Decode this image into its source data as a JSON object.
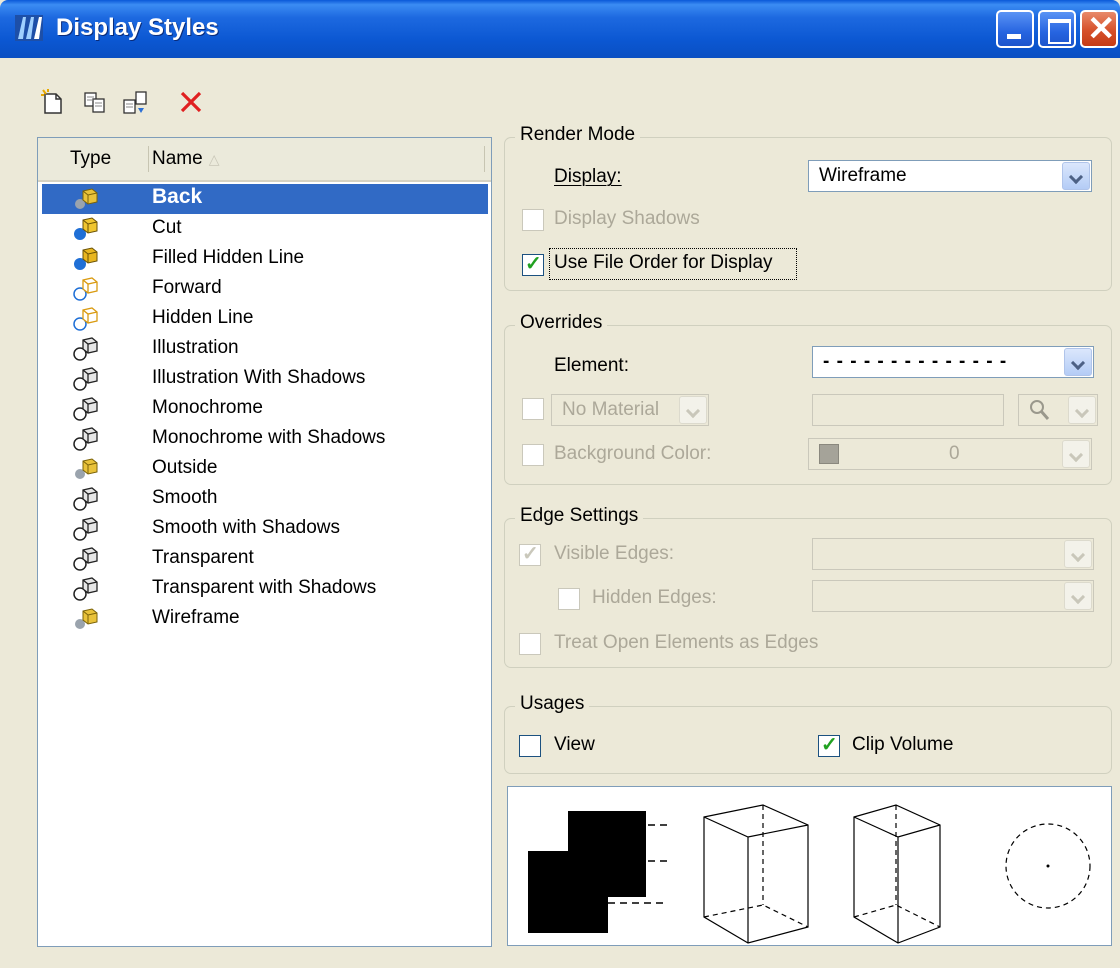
{
  "window": {
    "title": "Display Styles",
    "buttons": [
      "minimize",
      "maximize",
      "close"
    ],
    "title_bar_color": "#0a59d8"
  },
  "toolbar": {
    "icons": [
      "new-style-icon",
      "copy-style-icon",
      "import-style-icon",
      "delete-icon"
    ]
  },
  "list": {
    "columns": {
      "type": "Type",
      "name": "Name"
    },
    "sort": "name-ascending",
    "selected_color": "#316ac5",
    "items": [
      {
        "name": "Back",
        "icon": "render-shaded-icon",
        "selected": true
      },
      {
        "name": "Cut",
        "icon": "render-cut-icon",
        "selected": false
      },
      {
        "name": "Filled Hidden Line",
        "icon": "render-filled-icon",
        "selected": false
      },
      {
        "name": "Forward",
        "icon": "render-outline-icon",
        "selected": false
      },
      {
        "name": "Hidden Line",
        "icon": "render-outline-icon",
        "selected": false
      },
      {
        "name": "Illustration",
        "icon": "render-gray-icon",
        "selected": false
      },
      {
        "name": "Illustration With Shadows",
        "icon": "render-gray-icon",
        "selected": false
      },
      {
        "name": "Monochrome",
        "icon": "render-gray-icon",
        "selected": false
      },
      {
        "name": "Monochrome with Shadows",
        "icon": "render-gray-icon",
        "selected": false
      },
      {
        "name": "Outside",
        "icon": "render-shaded-icon",
        "selected": false
      },
      {
        "name": "Smooth",
        "icon": "render-gray-icon",
        "selected": false
      },
      {
        "name": "Smooth with Shadows",
        "icon": "render-gray-icon",
        "selected": false
      },
      {
        "name": "Transparent",
        "icon": "render-gray-icon",
        "selected": false
      },
      {
        "name": "Transparent with Shadows",
        "icon": "render-gray-icon",
        "selected": false
      },
      {
        "name": "Wireframe",
        "icon": "render-shaded-icon",
        "selected": false
      }
    ]
  },
  "render_mode": {
    "title": "Render Mode",
    "display_label": "Display:",
    "display_value": "Wireframe",
    "display_shadows_label": "Display Shadows",
    "display_shadows_checked": false,
    "use_file_order_label": "Use File Order for Display",
    "use_file_order_checked": true
  },
  "overrides": {
    "title": "Overrides",
    "element_label": "Element:",
    "element_value": "- - - - - - - - - - - - - -",
    "material_value": "No Material",
    "background_color_label": "Background Color:",
    "background_color_value": "0"
  },
  "edge_settings": {
    "title": "Edge Settings",
    "visible_edges_label": "Visible Edges:",
    "visible_edges_checked": true,
    "hidden_edges_label": "Hidden Edges:",
    "hidden_edges_checked": false,
    "treat_open_label": "Treat Open Elements as Edges",
    "treat_open_checked": false
  },
  "usages": {
    "title": "Usages",
    "view_label": "View",
    "view_checked": false,
    "clip_volume_label": "Clip Volume",
    "clip_volume_checked": true
  }
}
